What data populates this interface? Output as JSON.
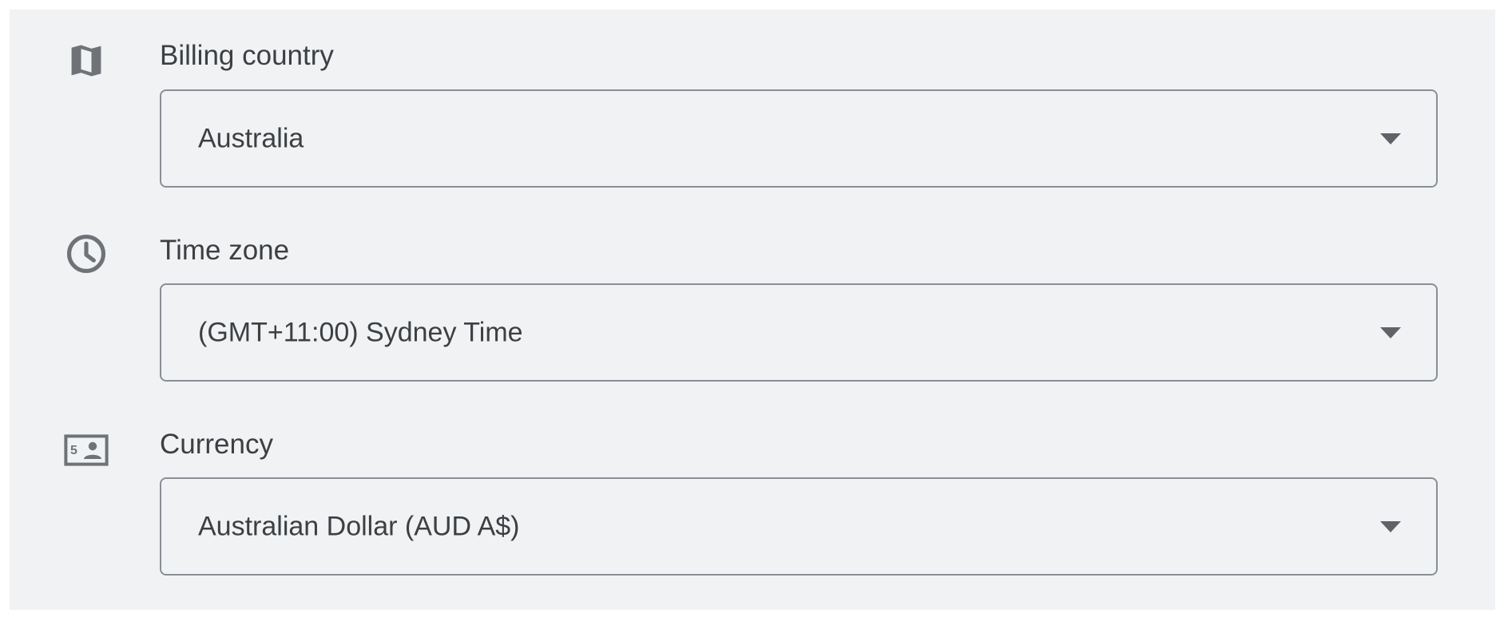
{
  "fields": [
    {
      "label": "Billing country",
      "value": "Australia",
      "icon": "map-icon"
    },
    {
      "label": "Time zone",
      "value": "(GMT+11:00) Sydney Time",
      "icon": "clock-icon"
    },
    {
      "label": "Currency",
      "value": "Australian Dollar (AUD A$)",
      "icon": "currency-bill-icon"
    }
  ],
  "colors": {
    "panel_background": "#f1f2f4",
    "text": "#3c4043",
    "icon": "#6f7377",
    "border": "#8a8f96",
    "arrow": "#5f6368"
  }
}
